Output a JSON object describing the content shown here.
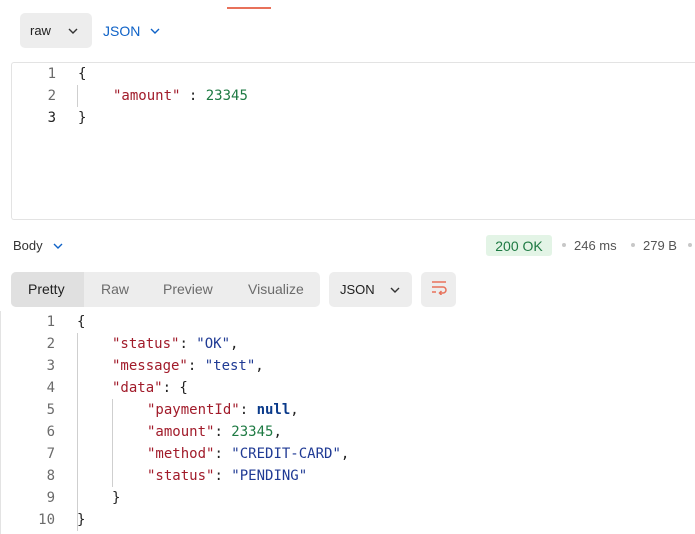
{
  "request": {
    "body_mode": "raw",
    "language": "JSON",
    "lines": [
      {
        "n": "1",
        "tokens": [
          {
            "t": "{",
            "c": "punc"
          }
        ]
      },
      {
        "n": "2",
        "tokens": [
          {
            "t": "\"amount\"",
            "c": "key"
          },
          {
            "t": " : ",
            "c": "punc"
          },
          {
            "t": "23345",
            "c": "num"
          }
        ]
      },
      {
        "n": "3",
        "tokens": [
          {
            "t": "}",
            "c": "punc"
          }
        ]
      }
    ]
  },
  "response": {
    "section_label": "Body",
    "status": "200 OK",
    "time": "246 ms",
    "size": "279 B",
    "tabs": [
      "Pretty",
      "Raw",
      "Preview",
      "Visualize"
    ],
    "active_tab": "Pretty",
    "language": "JSON",
    "lines": [
      {
        "n": "1",
        "tokens": [
          {
            "t": "{",
            "c": "punc"
          }
        ]
      },
      {
        "n": "2",
        "tokens": [
          {
            "t": "\"status\"",
            "c": "key"
          },
          {
            "t": ": ",
            "c": "punc"
          },
          {
            "t": "\"OK\"",
            "c": "str"
          },
          {
            "t": ",",
            "c": "punc"
          }
        ]
      },
      {
        "n": "3",
        "tokens": [
          {
            "t": "\"message\"",
            "c": "key"
          },
          {
            "t": ": ",
            "c": "punc"
          },
          {
            "t": "\"test\"",
            "c": "str"
          },
          {
            "t": ",",
            "c": "punc"
          }
        ]
      },
      {
        "n": "4",
        "tokens": [
          {
            "t": "\"data\"",
            "c": "key"
          },
          {
            "t": ": {",
            "c": "punc"
          }
        ]
      },
      {
        "n": "5",
        "tokens": [
          {
            "t": "\"paymentId\"",
            "c": "key"
          },
          {
            "t": ": ",
            "c": "punc"
          },
          {
            "t": "null",
            "c": "null"
          },
          {
            "t": ",",
            "c": "punc"
          }
        ]
      },
      {
        "n": "6",
        "tokens": [
          {
            "t": "\"amount\"",
            "c": "key"
          },
          {
            "t": ": ",
            "c": "punc"
          },
          {
            "t": "23345",
            "c": "num"
          },
          {
            "t": ",",
            "c": "punc"
          }
        ]
      },
      {
        "n": "7",
        "tokens": [
          {
            "t": "\"method\"",
            "c": "key"
          },
          {
            "t": ": ",
            "c": "punc"
          },
          {
            "t": "\"CREDIT-CARD\"",
            "c": "str"
          },
          {
            "t": ",",
            "c": "punc"
          }
        ]
      },
      {
        "n": "8",
        "tokens": [
          {
            "t": "\"status\"",
            "c": "key"
          },
          {
            "t": ": ",
            "c": "punc"
          },
          {
            "t": "\"PENDING\"",
            "c": "str"
          }
        ]
      },
      {
        "n": "9",
        "tokens": [
          {
            "t": "}",
            "c": "punc"
          }
        ]
      },
      {
        "n": "10",
        "tokens": [
          {
            "t": "}",
            "c": "punc"
          }
        ]
      }
    ]
  },
  "icons": {
    "chevron": "chevron-down-icon",
    "wrap": "wrap-lines-icon"
  },
  "colors": {
    "accent_blue": "#0f62c7",
    "status_green": "#1e7a43",
    "status_bg": "#e3f4e6",
    "json_key": "#a11b2a",
    "json_string": "#1f3a94",
    "wrap_icon": "#e8715a"
  }
}
